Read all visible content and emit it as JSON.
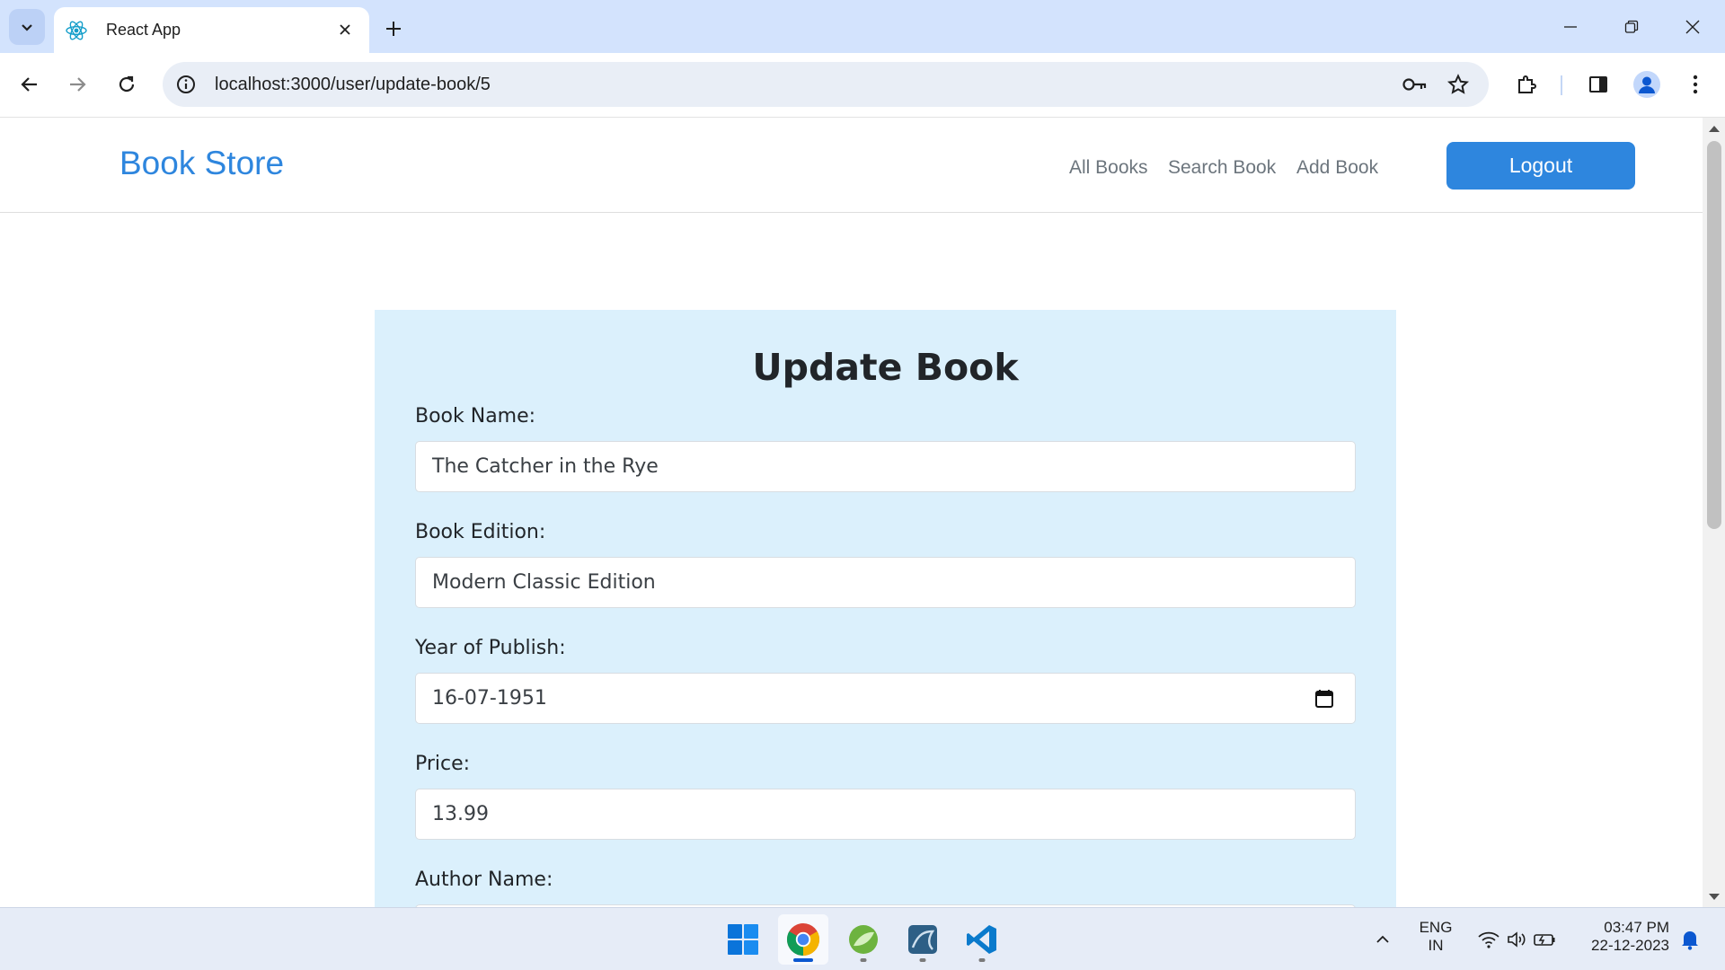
{
  "browser": {
    "tab_title": "React App",
    "url": "localhost:3000/user/update-book/5"
  },
  "navbar": {
    "brand": "Book Store",
    "links": [
      "All Books",
      "Search Book",
      "Add Book"
    ],
    "logout_label": "Logout"
  },
  "form": {
    "title": "Update Book",
    "fields": [
      {
        "label": "Book Name:",
        "value": "The Catcher in the Rye"
      },
      {
        "label": "Book Edition:",
        "value": "Modern Classic Edition"
      },
      {
        "label": "Year of Publish:",
        "value": "16-07-1951"
      },
      {
        "label": "Price:",
        "value": "13.99"
      },
      {
        "label": "Author Name:",
        "value": ""
      }
    ]
  },
  "taskbar": {
    "language": "ENG",
    "region": "IN",
    "time": "03:47 PM",
    "date": "22-12-2023",
    "apps": [
      "start-icon",
      "chrome-icon",
      "spring-tool-suite-icon",
      "mysql-workbench-icon",
      "vscode-icon"
    ]
  },
  "colors": {
    "brand": "#2e86de",
    "card_background": "#dbf0fc",
    "tabstrip": "#d3e3fd"
  }
}
